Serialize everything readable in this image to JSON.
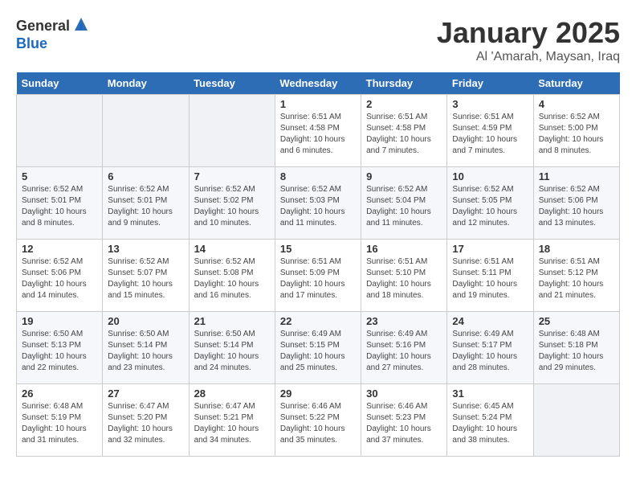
{
  "header": {
    "logo_general": "General",
    "logo_blue": "Blue",
    "month_title": "January 2025",
    "location": "Al 'Amarah, Maysan, Iraq"
  },
  "weekdays": [
    "Sunday",
    "Monday",
    "Tuesday",
    "Wednesday",
    "Thursday",
    "Friday",
    "Saturday"
  ],
  "weeks": [
    [
      {
        "day": "",
        "info": ""
      },
      {
        "day": "",
        "info": ""
      },
      {
        "day": "",
        "info": ""
      },
      {
        "day": "1",
        "info": "Sunrise: 6:51 AM\nSunset: 4:58 PM\nDaylight: 10 hours\nand 6 minutes."
      },
      {
        "day": "2",
        "info": "Sunrise: 6:51 AM\nSunset: 4:58 PM\nDaylight: 10 hours\nand 7 minutes."
      },
      {
        "day": "3",
        "info": "Sunrise: 6:51 AM\nSunset: 4:59 PM\nDaylight: 10 hours\nand 7 minutes."
      },
      {
        "day": "4",
        "info": "Sunrise: 6:52 AM\nSunset: 5:00 PM\nDaylight: 10 hours\nand 8 minutes."
      }
    ],
    [
      {
        "day": "5",
        "info": "Sunrise: 6:52 AM\nSunset: 5:01 PM\nDaylight: 10 hours\nand 8 minutes."
      },
      {
        "day": "6",
        "info": "Sunrise: 6:52 AM\nSunset: 5:01 PM\nDaylight: 10 hours\nand 9 minutes."
      },
      {
        "day": "7",
        "info": "Sunrise: 6:52 AM\nSunset: 5:02 PM\nDaylight: 10 hours\nand 10 minutes."
      },
      {
        "day": "8",
        "info": "Sunrise: 6:52 AM\nSunset: 5:03 PM\nDaylight: 10 hours\nand 11 minutes."
      },
      {
        "day": "9",
        "info": "Sunrise: 6:52 AM\nSunset: 5:04 PM\nDaylight: 10 hours\nand 11 minutes."
      },
      {
        "day": "10",
        "info": "Sunrise: 6:52 AM\nSunset: 5:05 PM\nDaylight: 10 hours\nand 12 minutes."
      },
      {
        "day": "11",
        "info": "Sunrise: 6:52 AM\nSunset: 5:06 PM\nDaylight: 10 hours\nand 13 minutes."
      }
    ],
    [
      {
        "day": "12",
        "info": "Sunrise: 6:52 AM\nSunset: 5:06 PM\nDaylight: 10 hours\nand 14 minutes."
      },
      {
        "day": "13",
        "info": "Sunrise: 6:52 AM\nSunset: 5:07 PM\nDaylight: 10 hours\nand 15 minutes."
      },
      {
        "day": "14",
        "info": "Sunrise: 6:52 AM\nSunset: 5:08 PM\nDaylight: 10 hours\nand 16 minutes."
      },
      {
        "day": "15",
        "info": "Sunrise: 6:51 AM\nSunset: 5:09 PM\nDaylight: 10 hours\nand 17 minutes."
      },
      {
        "day": "16",
        "info": "Sunrise: 6:51 AM\nSunset: 5:10 PM\nDaylight: 10 hours\nand 18 minutes."
      },
      {
        "day": "17",
        "info": "Sunrise: 6:51 AM\nSunset: 5:11 PM\nDaylight: 10 hours\nand 19 minutes."
      },
      {
        "day": "18",
        "info": "Sunrise: 6:51 AM\nSunset: 5:12 PM\nDaylight: 10 hours\nand 21 minutes."
      }
    ],
    [
      {
        "day": "19",
        "info": "Sunrise: 6:50 AM\nSunset: 5:13 PM\nDaylight: 10 hours\nand 22 minutes."
      },
      {
        "day": "20",
        "info": "Sunrise: 6:50 AM\nSunset: 5:14 PM\nDaylight: 10 hours\nand 23 minutes."
      },
      {
        "day": "21",
        "info": "Sunrise: 6:50 AM\nSunset: 5:14 PM\nDaylight: 10 hours\nand 24 minutes."
      },
      {
        "day": "22",
        "info": "Sunrise: 6:49 AM\nSunset: 5:15 PM\nDaylight: 10 hours\nand 25 minutes."
      },
      {
        "day": "23",
        "info": "Sunrise: 6:49 AM\nSunset: 5:16 PM\nDaylight: 10 hours\nand 27 minutes."
      },
      {
        "day": "24",
        "info": "Sunrise: 6:49 AM\nSunset: 5:17 PM\nDaylight: 10 hours\nand 28 minutes."
      },
      {
        "day": "25",
        "info": "Sunrise: 6:48 AM\nSunset: 5:18 PM\nDaylight: 10 hours\nand 29 minutes."
      }
    ],
    [
      {
        "day": "26",
        "info": "Sunrise: 6:48 AM\nSunset: 5:19 PM\nDaylight: 10 hours\nand 31 minutes."
      },
      {
        "day": "27",
        "info": "Sunrise: 6:47 AM\nSunset: 5:20 PM\nDaylight: 10 hours\nand 32 minutes."
      },
      {
        "day": "28",
        "info": "Sunrise: 6:47 AM\nSunset: 5:21 PM\nDaylight: 10 hours\nand 34 minutes."
      },
      {
        "day": "29",
        "info": "Sunrise: 6:46 AM\nSunset: 5:22 PM\nDaylight: 10 hours\nand 35 minutes."
      },
      {
        "day": "30",
        "info": "Sunrise: 6:46 AM\nSunset: 5:23 PM\nDaylight: 10 hours\nand 37 minutes."
      },
      {
        "day": "31",
        "info": "Sunrise: 6:45 AM\nSunset: 5:24 PM\nDaylight: 10 hours\nand 38 minutes."
      },
      {
        "day": "",
        "info": ""
      }
    ]
  ]
}
